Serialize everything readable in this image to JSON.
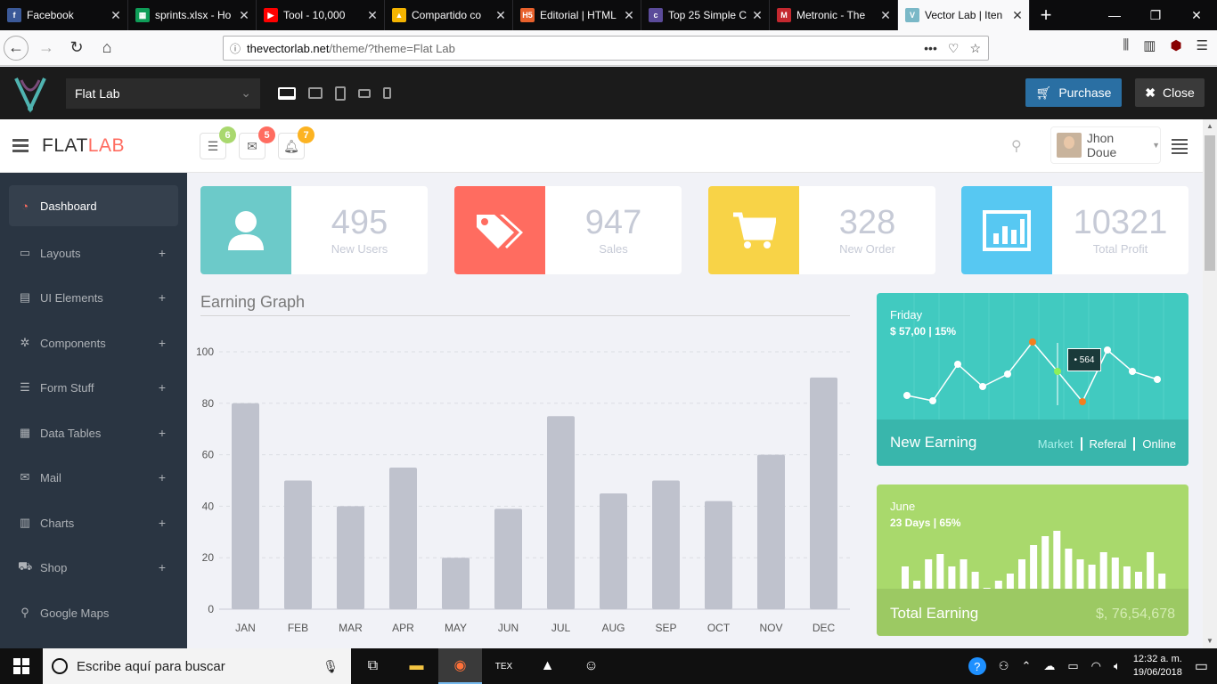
{
  "browser": {
    "tabs": [
      {
        "title": "Facebook",
        "favicon_color": "#3b5998",
        "favicon_text": "f"
      },
      {
        "title": "sprints.xlsx - Ho",
        "favicon_color": "#0f9d58",
        "favicon_text": "▦"
      },
      {
        "title": "Tool - 10,000",
        "favicon_color": "#ff0000",
        "favicon_text": "▶"
      },
      {
        "title": "Compartido co",
        "favicon_color": "#f4b400",
        "favicon_text": "▲"
      },
      {
        "title": "Editorial | HTML",
        "favicon_color": "#e8612c",
        "favicon_text": "H5"
      },
      {
        "title": "Top 25 Simple C",
        "favicon_color": "#5b4b9a",
        "favicon_text": "c"
      },
      {
        "title": "Metronic - The",
        "favicon_color": "#c4282f",
        "favicon_text": "M"
      },
      {
        "title": "Vector Lab | Iten",
        "favicon_color": "#7ab8c7",
        "favicon_text": "V",
        "active": true
      }
    ],
    "url_domain": "thevectorlab.net",
    "url_path": "/theme/?theme=Flat Lab"
  },
  "themebar": {
    "selected_theme": "Flat Lab",
    "purchase_label": "Purchase",
    "close_label": "Close"
  },
  "header": {
    "brand_a": "FLAT",
    "brand_b": "LAB",
    "badges": [
      {
        "count": "6",
        "color": "#a9d86e",
        "icon": "task-icon"
      },
      {
        "count": "5",
        "color": "#ff6c60",
        "icon": "envelope-icon"
      },
      {
        "count": "7",
        "color": "#fcb322",
        "icon": "bell-icon"
      }
    ],
    "user_name": "Jhon Doue"
  },
  "sidebar": {
    "items": [
      {
        "label": "Dashboard",
        "icon": "dashboard-icon",
        "glyph": "◔",
        "active": true
      },
      {
        "label": "Layouts",
        "icon": "laptop-icon",
        "glyph": "▭",
        "plus": "+"
      },
      {
        "label": "UI Elements",
        "icon": "book-icon",
        "glyph": "▤",
        "plus": "+"
      },
      {
        "label": "Components",
        "icon": "cogs-icon",
        "glyph": "✲",
        "plus": "+"
      },
      {
        "label": "Form Stuff",
        "icon": "tasks-icon",
        "glyph": "☰",
        "plus": "+"
      },
      {
        "label": "Data Tables",
        "icon": "th-icon",
        "glyph": "▦",
        "plus": "+"
      },
      {
        "label": "Mail",
        "icon": "envelope-icon",
        "glyph": "✉",
        "plus": "+"
      },
      {
        "label": "Charts",
        "icon": "bar-chart-icon",
        "glyph": "▥",
        "plus": "+"
      },
      {
        "label": "Shop",
        "icon": "cart-icon",
        "glyph": "⛟",
        "plus": "+"
      },
      {
        "label": "Google Maps",
        "icon": "map-marker-icon",
        "glyph": "⚲"
      }
    ]
  },
  "stats": [
    {
      "value": "495",
      "label": "New Users",
      "color": "#6ccac9",
      "icon": "user-icon"
    },
    {
      "value": "947",
      "label": "Sales",
      "color": "#ff6c60",
      "icon": "tags-icon"
    },
    {
      "value": "328",
      "label": "New Order",
      "color": "#f8d347",
      "icon": "shopping-cart-icon"
    },
    {
      "value": "10321",
      "label": "Total Profit",
      "color": "#57c8f2",
      "icon": "bar-chart-icon"
    }
  ],
  "earning_graph": {
    "title": "Earning Graph"
  },
  "chart_data": {
    "type": "bar",
    "categories": [
      "JAN",
      "FEB",
      "MAR",
      "APR",
      "MAY",
      "JUN",
      "JUL",
      "AUG",
      "SEP",
      "OCT",
      "NOV",
      "DEC"
    ],
    "values": [
      80,
      50,
      40,
      55,
      20,
      39,
      75,
      45,
      50,
      42,
      60,
      90
    ],
    "ylim": [
      0,
      100
    ],
    "yticks": [
      0,
      20,
      40,
      60,
      80,
      100
    ],
    "bar_color": "#bfc2cd",
    "grid": true
  },
  "panel_new_earning": {
    "day": "Friday",
    "amount": "$ 57,00 | 15%",
    "title": "New Earning",
    "links": [
      "Market",
      "Referal",
      "Online"
    ],
    "tooltip": "• 564"
  },
  "panel_total_earning": {
    "day": "June",
    "amount": "23 Days | 65%",
    "title": "Total Earning",
    "value": "$, 76,54,678"
  },
  "taskbar": {
    "search_placeholder": "Escribe aquí para buscar",
    "time": "12:32 a. m.",
    "date": "19/06/2018"
  }
}
